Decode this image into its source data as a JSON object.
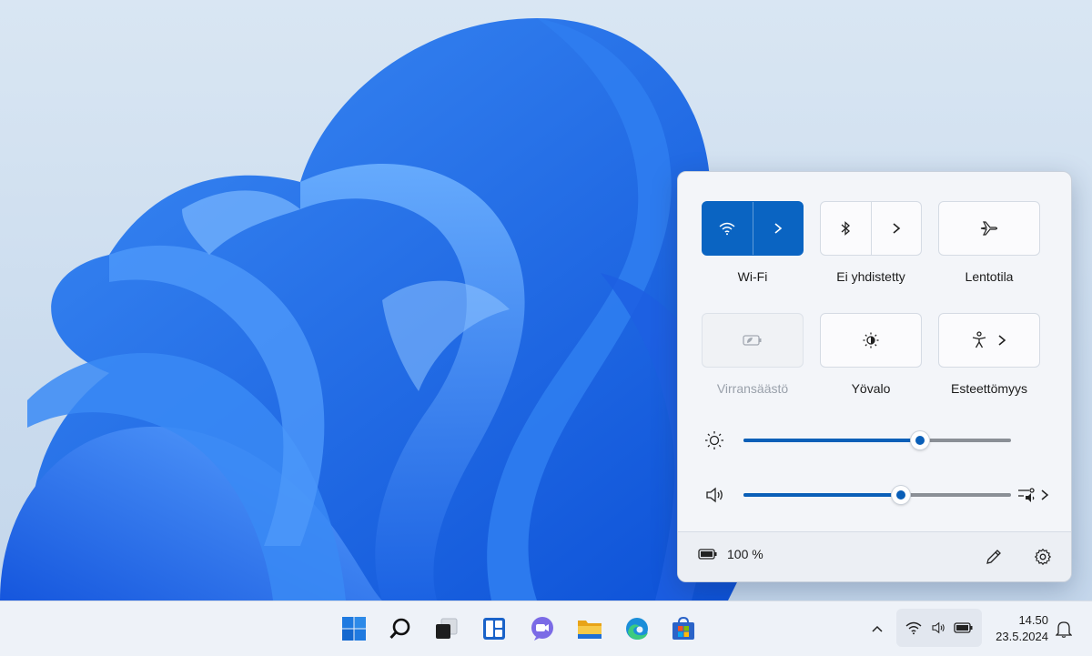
{
  "quick_settings": {
    "tiles": [
      {
        "label": "Wi-Fi",
        "state": "on",
        "icon": "wifi-icon",
        "has_chevron": true
      },
      {
        "label": "Ei yhdistetty",
        "state": "off",
        "icon": "bluetooth-icon",
        "has_chevron": true
      },
      {
        "label": "Lentotila",
        "state": "off",
        "icon": "airplane-icon",
        "has_chevron": false
      },
      {
        "label": "Virransäästö",
        "state": "disabled",
        "icon": "battery-saver-icon",
        "has_chevron": false
      },
      {
        "label": "Yövalo",
        "state": "off",
        "icon": "night-light-icon",
        "has_chevron": false
      },
      {
        "label": "Esteettömyys",
        "state": "off",
        "icon": "accessibility-icon",
        "has_chevron": true
      }
    ],
    "brightness": {
      "icon": "brightness-icon",
      "value_fraction": 0.66
    },
    "volume": {
      "icon": "speaker-icon",
      "value_fraction": 0.59,
      "output_icon": "audio-output-icon"
    },
    "footer": {
      "battery_icon": "battery-icon",
      "battery_text": "100 %",
      "edit_icon": "pencil-icon",
      "settings_icon": "gear-icon"
    }
  },
  "taskbar": {
    "apps": [
      "windows-start-icon",
      "search-icon",
      "task-view-icon",
      "widgets-icon",
      "teams-chat-icon",
      "file-explorer-icon",
      "edge-icon",
      "store-icon"
    ],
    "tray": {
      "chevron_icon": "chevron-up-icon",
      "icons": [
        "wifi-icon",
        "speaker-icon",
        "battery-icon"
      ]
    },
    "clock": {
      "time": "14.50",
      "date": "23.5.2024"
    },
    "notification_icon": "bell-icon"
  },
  "colors": {
    "accent": "#0a64c2",
    "wallpaper_blue": "#1f6fe6"
  }
}
